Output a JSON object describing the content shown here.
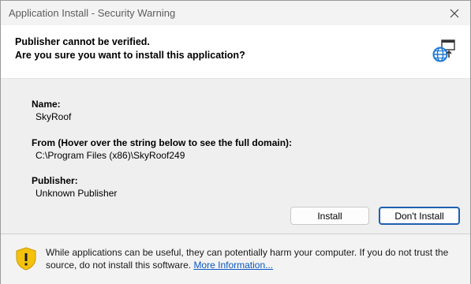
{
  "window": {
    "title": "Application Install - Security Warning"
  },
  "header": {
    "line1": "Publisher cannot be verified.",
    "line2": "Are you sure you want to install this application?"
  },
  "details": {
    "name_label": "Name:",
    "name_value": "SkyRoof",
    "from_label": "From (Hover over the string below to see the full domain):",
    "from_value": "C:\\Program Files (x86)\\SkyRoof249",
    "publisher_label": "Publisher:",
    "publisher_value": "Unknown Publisher"
  },
  "buttons": {
    "install": "Install",
    "dont_install": "Don't Install"
  },
  "footer": {
    "warning_text": "While applications can be useful, they can potentially harm your computer. If you do not trust the source, do not install this software. ",
    "more_info": "More Information..."
  },
  "icons": {
    "close": "close-icon",
    "globe": "globe-install-icon",
    "warning": "shield-warning-icon"
  },
  "colors": {
    "link": "#0b57c5",
    "default_button_border": "#1f5fb2",
    "shield": "#f4c20d"
  }
}
